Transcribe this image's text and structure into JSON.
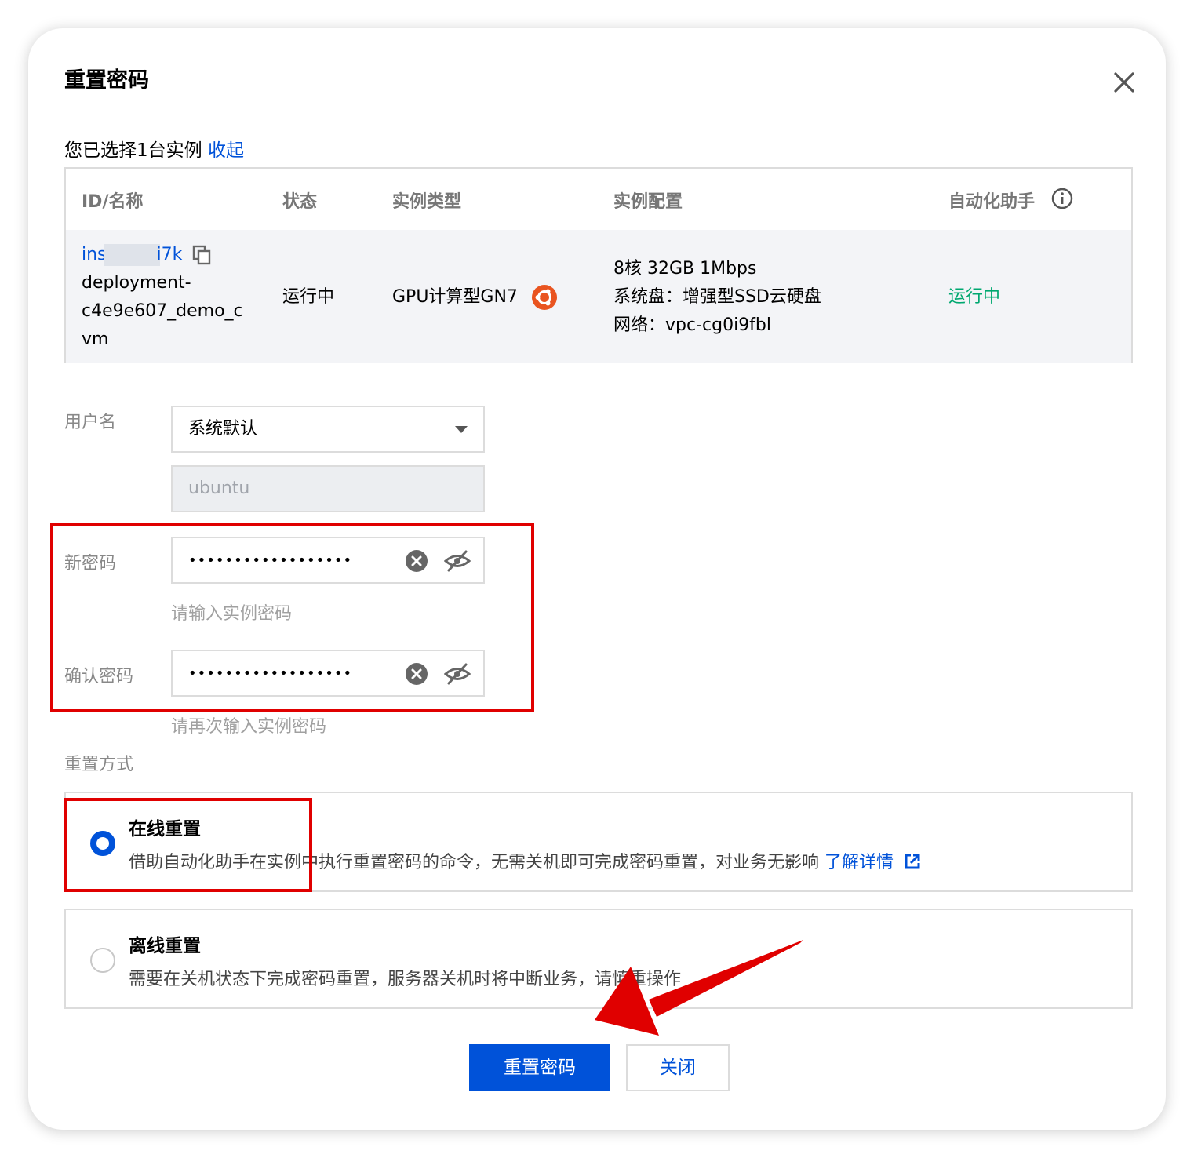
{
  "dialog": {
    "title": "重置密码",
    "selected_text": "您已选择1台实例",
    "collapse_link": "收起"
  },
  "table": {
    "headers": {
      "id_name": "ID/名称",
      "status": "状态",
      "type": "实例类型",
      "config": "实例配置",
      "agent": "自动化助手"
    },
    "row": {
      "id_prefix": "ins",
      "id_suffix": "i7k",
      "name_line1": "deployment-",
      "name_line2": "c4e9e607_demo_c",
      "name_line3": "vm",
      "status": "运行中",
      "type": "GPU计算型GN7",
      "config_line1": "8核 32GB 1Mbps",
      "config_line2": "系统盘：增强型SSD云硬盘",
      "config_line3": "网络：vpc-cg0i9fbl",
      "agent_status": "运行中"
    }
  },
  "form": {
    "username_label": "用户名",
    "username_select": "系统默认",
    "username_value": "ubuntu",
    "new_password_label": "新密码",
    "new_password_value": "••••••••••••••••••",
    "new_password_hint": "请输入实例密码",
    "confirm_password_label": "确认密码",
    "confirm_password_value": "••••••••••••••••••",
    "confirm_password_hint": "请再次输入实例密码",
    "reset_method_label": "重置方式"
  },
  "options": {
    "online_title": "在线重置",
    "online_desc": "借助自动化助手在实例中执行重置密码的命令，无需关机即可完成密码重置，对业务无影响",
    "online_link": "了解详情",
    "offline_title": "离线重置",
    "offline_desc": "需要在关机状态下完成密码重置，服务器关机时将中断业务，请慎重操作"
  },
  "buttons": {
    "primary": "重置密码",
    "secondary": "关闭"
  },
  "colors": {
    "primary": "#0052d9",
    "success": "#00a870",
    "annotation": "#e00000"
  }
}
